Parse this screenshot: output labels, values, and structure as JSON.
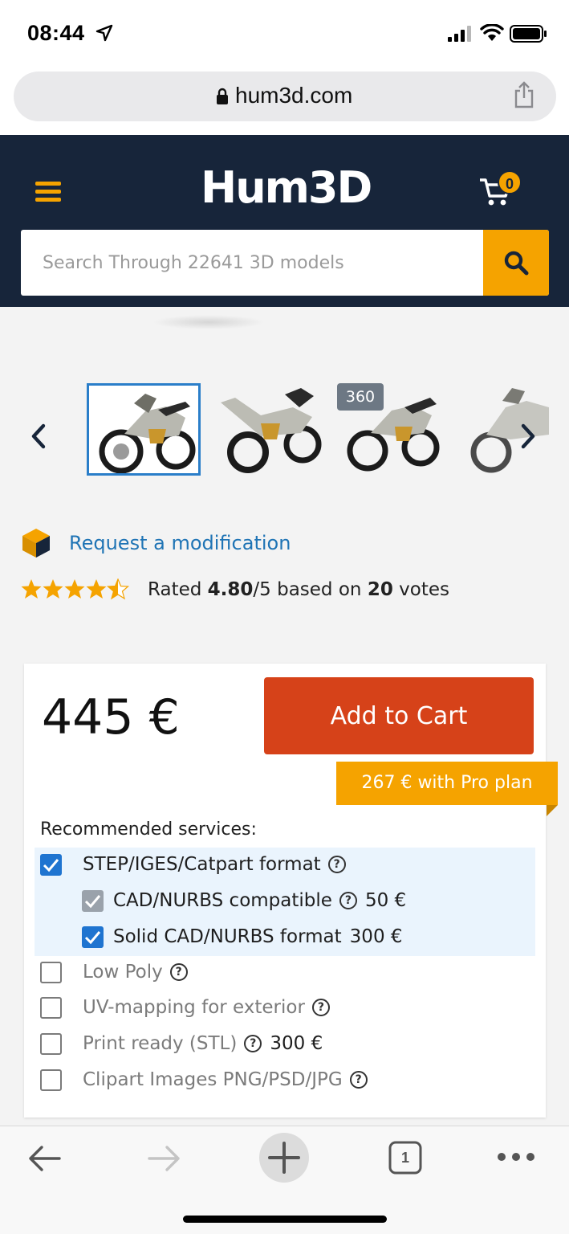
{
  "status_bar": {
    "time": "08:44"
  },
  "browser": {
    "url": "hum3d.com"
  },
  "site": {
    "logo": "Hum3D",
    "cart_count": "0",
    "search_placeholder": "Search Through 22641 3D models",
    "accent_color": "#f5a300",
    "header_color": "#17253a"
  },
  "gallery": {
    "badge": "360"
  },
  "product": {
    "request_link": "Request a modification",
    "rating_prefix": "Rated",
    "rating_value": "4.80",
    "rating_scale": "/5",
    "rating_mid": "based on",
    "votes": "20",
    "votes_suffix": "votes",
    "stars": 4.5,
    "price": "445 €",
    "add_to_cart": "Add to Cart",
    "pro_plan": "267 € with Pro plan",
    "services_heading": "Recommended services:",
    "services": [
      {
        "label": "STEP/IGES/Catpart format",
        "help": true,
        "price": "",
        "checked": true
      },
      {
        "label": "CAD/NURBS compatible",
        "help": true,
        "price": "50 €",
        "checked": true,
        "disabled": true
      },
      {
        "label": "Solid CAD/NURBS format",
        "help": false,
        "price": "300 €",
        "checked": true
      },
      {
        "label": "Low Poly",
        "help": true,
        "price": "",
        "checked": false
      },
      {
        "label": "UV-mapping for exterior",
        "help": true,
        "price": "",
        "checked": false
      },
      {
        "label": "Print ready (STL)",
        "help": true,
        "price": "300 €",
        "checked": false
      },
      {
        "label": "Clipart Images PNG/PSD/JPG",
        "help": true,
        "price": "",
        "checked": false
      }
    ]
  },
  "toolbar": {
    "tab_count": "1"
  }
}
